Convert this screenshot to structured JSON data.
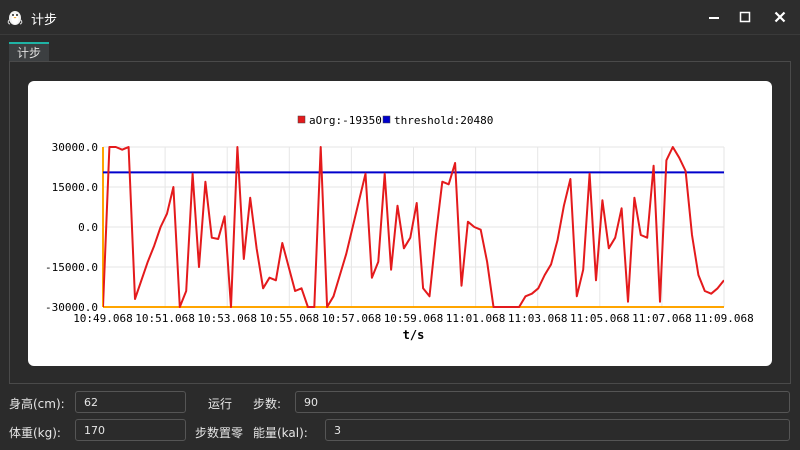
{
  "window": {
    "title": "计步"
  },
  "tabs": [
    {
      "label": "计步"
    }
  ],
  "chart_data": {
    "type": "line",
    "legend": {
      "placement": "top-center"
    },
    "series": [
      {
        "name": "aOrg:-19350",
        "color": "#e41a1c",
        "values": [
          -30000,
          30000,
          30000,
          29000,
          30000,
          -27000,
          -20000,
          -13000,
          -7000,
          0,
          5000,
          15000,
          -30000,
          -24000,
          20000,
          -15000,
          17000,
          -4000,
          -4500,
          4000,
          -30000,
          30000,
          -12000,
          11000,
          -8000,
          -23000,
          -19000,
          -20000,
          -6000,
          -15000,
          -24000,
          -23000,
          -30000,
          -30000,
          30000,
          -30000,
          -26000,
          -18000,
          -10000,
          0,
          10000,
          20000,
          -19000,
          -13000,
          20000,
          -16000,
          8000,
          -8000,
          -4000,
          9000,
          -23000,
          -26000,
          -3000,
          17000,
          16000,
          24000,
          -22000,
          2000,
          0,
          -1000,
          -13000,
          -30000,
          -30000,
          -30000,
          -30000,
          -30000,
          -26000,
          -25000,
          -23000,
          -18000,
          -14000,
          -5000,
          8000,
          18000,
          -26000,
          -16000,
          20000,
          -20000,
          10000,
          -8000,
          -4000,
          7000,
          -28000,
          11000,
          -3000,
          -4000,
          23000,
          -28000,
          25000,
          30000,
          26000,
          21000,
          -3000,
          -18000,
          -24000,
          -25000,
          -23000,
          -20000
        ]
      },
      {
        "name": "threshold:20480",
        "color": "#0000cc",
        "values": [
          20480
        ]
      }
    ],
    "x_start_label": "10:49.068",
    "x_end_label": "11:09.068",
    "xlabel": "t/s",
    "ylabel": "",
    "x_ticks": [
      "10:49.068",
      "10:51.068",
      "10:53.068",
      "10:55.068",
      "10:57.068",
      "10:59.068",
      "11:01.068",
      "11:03.068",
      "11:05.068",
      "11:07.068",
      "11:09.068"
    ],
    "y_ticks": [
      "30000.0",
      "15000.0",
      "0.0",
      "-15000.0",
      "-30000.0"
    ],
    "y_tick_values": [
      30000,
      15000,
      0,
      -15000,
      -30000
    ],
    "ylim": [
      -30000,
      30000
    ],
    "grid": true,
    "axis_color": "#ffa500"
  },
  "form": {
    "height_label": "身高(cm):",
    "height_value": "62",
    "weight_label": "体重(kg):",
    "weight_value": "170",
    "run_button": "运行",
    "reset_button": "步数置零",
    "steps_label": "步数:",
    "steps_value": "90",
    "energy_label": "能量(kal):",
    "energy_value": "3"
  }
}
